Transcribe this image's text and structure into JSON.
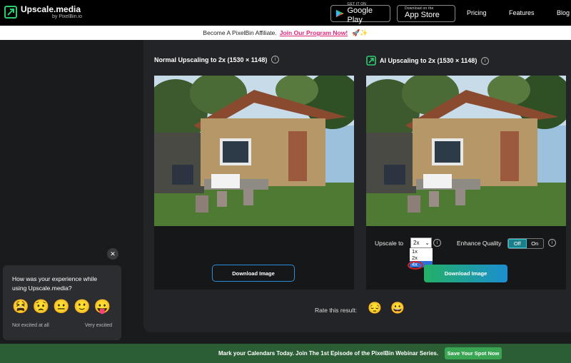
{
  "header": {
    "logo_name": "Upscale.media",
    "logo_by": "by PixelBin.io",
    "google_play": {
      "small": "GET IT ON",
      "big": "Google Play"
    },
    "app_store": {
      "small": "Download on the",
      "big": "App Store"
    },
    "nav": [
      "Pricing",
      "Features",
      "Blog"
    ]
  },
  "affiliate": {
    "text": "Become A PixelBin Affiliate.",
    "link": "Join Our Program Now!",
    "emoji": "🚀✨"
  },
  "normal": {
    "title": "Normal Upscaling to 2x (1530 × 1148)",
    "download_label": "Download Image"
  },
  "ai": {
    "title": "AI Upscaling to 2x (1530 × 1148)",
    "upscale_label": "Upscale to",
    "upscale_value": "2x",
    "upscale_options": [
      "1x",
      "2x",
      "4x"
    ],
    "enhance_label": "Enhance Quality",
    "toggle_off": "Off",
    "toggle_on": "On",
    "download_label": "Download Image"
  },
  "rating": {
    "label": "Rate this result:",
    "emojis": [
      "😔",
      "😀"
    ]
  },
  "feedback": {
    "question": "How was your experience while using Upscale.media?",
    "emojis": [
      "😫",
      "😟",
      "😐",
      "🙂",
      "😛"
    ],
    "low": "Not excited at all",
    "high": "Very excited"
  },
  "bottom": {
    "text": "Mark your Calendars Today. Join The 1st Episode of the PixelBin Webinar Series.",
    "button": "Save Your Spot Now"
  },
  "colors": {
    "accent_green": "#39a452",
    "link_pink": "#e2247a",
    "toggle_teal": "#1c7e88"
  }
}
